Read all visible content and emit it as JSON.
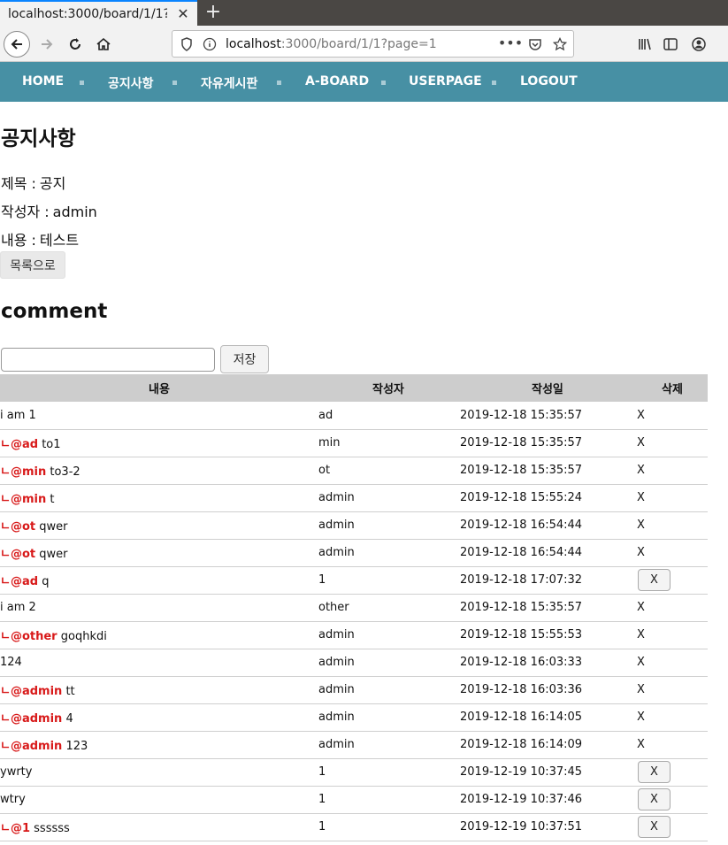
{
  "browser": {
    "tab_title": "localhost:3000/board/1/1?p",
    "url_host": "localhost",
    "url_rest": ":3000/board/1/1?page=1"
  },
  "menu": {
    "items": [
      "HOME",
      "공지사항",
      "자유게시판",
      "A-BOARD",
      "USERPAGE",
      "LOGOUT"
    ]
  },
  "post": {
    "board_title": "공지사항",
    "title_label": "제목 :",
    "title": "공지",
    "writer_label": "작성자 :",
    "writer": "admin",
    "content_label": "내용 :",
    "content": "테스트",
    "list_button": "목록으로"
  },
  "comment_section": {
    "heading": "comment",
    "input_value": "",
    "save_button": "저장",
    "columns": [
      "내용",
      "작성자",
      "작성일",
      "삭제"
    ],
    "rows": [
      {
        "reply": false,
        "mention": "",
        "text": "i am 1",
        "writer": "ad",
        "date": "2019-12-18 15:35:57",
        "delete": "X",
        "delete_button": false
      },
      {
        "reply": true,
        "mention": "@ad",
        "text": "to1",
        "writer": "min",
        "date": "2019-12-18 15:35:57",
        "delete": "X",
        "delete_button": false
      },
      {
        "reply": true,
        "mention": "@min",
        "text": "to3-2",
        "writer": "ot",
        "date": "2019-12-18 15:35:57",
        "delete": "X",
        "delete_button": false
      },
      {
        "reply": true,
        "mention": "@min",
        "text": "t",
        "writer": "admin",
        "date": "2019-12-18 15:55:24",
        "delete": "X",
        "delete_button": false
      },
      {
        "reply": true,
        "mention": "@ot",
        "text": "qwer",
        "writer": "admin",
        "date": "2019-12-18 16:54:44",
        "delete": "X",
        "delete_button": false
      },
      {
        "reply": true,
        "mention": "@ot",
        "text": "qwer",
        "writer": "admin",
        "date": "2019-12-18 16:54:44",
        "delete": "X",
        "delete_button": false
      },
      {
        "reply": true,
        "mention": "@ad",
        "text": "q",
        "writer": "1",
        "date": "2019-12-18 17:07:32",
        "delete": "X",
        "delete_button": true
      },
      {
        "reply": false,
        "mention": "",
        "text": "i am 2",
        "writer": "other",
        "date": "2019-12-18 15:35:57",
        "delete": "X",
        "delete_button": false
      },
      {
        "reply": true,
        "mention": "@other",
        "text": "goqhkdi",
        "writer": "admin",
        "date": "2019-12-18 15:55:53",
        "delete": "X",
        "delete_button": false
      },
      {
        "reply": false,
        "mention": "",
        "text": "124",
        "writer": "admin",
        "date": "2019-12-18 16:03:33",
        "delete": "X",
        "delete_button": false
      },
      {
        "reply": true,
        "mention": "@admin",
        "text": "tt",
        "writer": "admin",
        "date": "2019-12-18 16:03:36",
        "delete": "X",
        "delete_button": false
      },
      {
        "reply": true,
        "mention": "@admin",
        "text": "4",
        "writer": "admin",
        "date": "2019-12-18 16:14:05",
        "delete": "X",
        "delete_button": false
      },
      {
        "reply": true,
        "mention": "@admin",
        "text": "123",
        "writer": "admin",
        "date": "2019-12-18 16:14:09",
        "delete": "X",
        "delete_button": false
      },
      {
        "reply": false,
        "mention": "",
        "text": "ywrty",
        "writer": "1",
        "date": "2019-12-19 10:37:45",
        "delete": "X",
        "delete_button": true
      },
      {
        "reply": false,
        "mention": "",
        "text": "wtry",
        "writer": "1",
        "date": "2019-12-19 10:37:46",
        "delete": "X",
        "delete_button": true
      },
      {
        "reply": true,
        "mention": "@1",
        "text": "ssssss",
        "writer": "1",
        "date": "2019-12-19 10:37:51",
        "delete": "X",
        "delete_button": true
      }
    ]
  },
  "colors": {
    "menu_bg": "#4790a4",
    "mention": "#d81919",
    "table_header": "#cdcdcd"
  }
}
